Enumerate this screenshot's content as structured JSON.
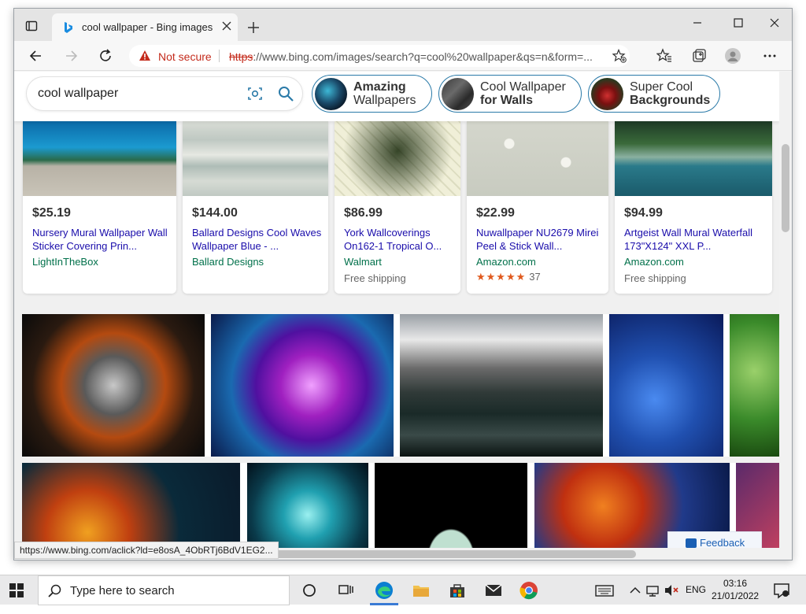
{
  "browser": {
    "tab_title": "cool wallpaper - Bing images",
    "security_label": "Not secure",
    "url_scheme": "https",
    "url_rest": "://www.bing.com/images/search?q=cool%20wallpaper&qs=n&form=..."
  },
  "search": {
    "query": "cool wallpaper"
  },
  "suggestions": [
    {
      "line1": "Amazing",
      "line2": "Wallpapers"
    },
    {
      "line1": "Cool Wallpaper",
      "line2": "for Walls"
    },
    {
      "line1": "Super Cool",
      "line2": "Backgrounds"
    }
  ],
  "products": [
    {
      "price": "$25.19",
      "name": "Nursery Mural Wallpaper Wall Sticker Covering Prin...",
      "seller": "LightInTheBox",
      "extra": ""
    },
    {
      "price": "$144.00",
      "name": "Ballard Designs Cool Waves Wallpaper Blue - ...",
      "seller": "Ballard Designs",
      "extra": ""
    },
    {
      "price": "$86.99",
      "name": "York Wallcoverings On162-1 Tropical O...",
      "seller": "Walmart",
      "extra": "Free shipping"
    },
    {
      "price": "$22.99",
      "name": "Nuwallpaper NU2679 Mirei Peel & Stick Wall...",
      "seller": "Amazon.com",
      "extra": "",
      "rating_count": "37",
      "rating": 4.5
    },
    {
      "price": "$94.99",
      "name": "Artgeist Wall Mural Waterfall 173\"X124\" XXL P...",
      "seller": "Amazon.com",
      "extra": "Free shipping"
    }
  ],
  "feedback_label": "Feedback",
  "status_url": "https://www.bing.com/aclick?ld=e8osA_4ObRTj6BdV1EG2...",
  "taskbar": {
    "search_placeholder": "Type here to search",
    "language": "ENG",
    "time": "03:16",
    "date": "21/01/2022"
  }
}
